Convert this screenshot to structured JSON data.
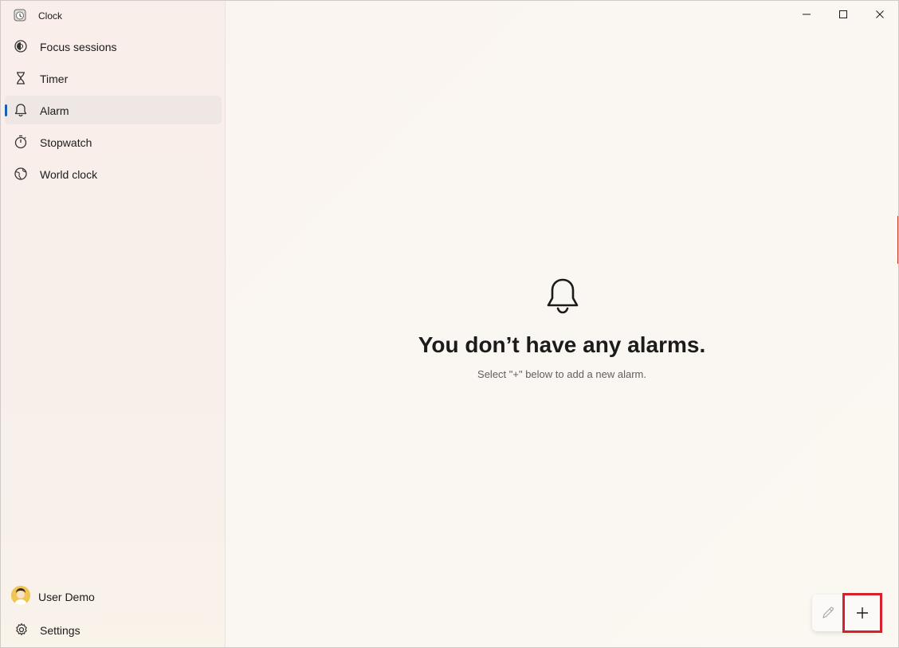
{
  "window": {
    "title": "Clock"
  },
  "sidebar": {
    "items": [
      {
        "label": "Focus sessions",
        "icon": "focus-icon"
      },
      {
        "label": "Timer",
        "icon": "hourglass-icon"
      },
      {
        "label": "Alarm",
        "icon": "bell-icon",
        "active": true
      },
      {
        "label": "Stopwatch",
        "icon": "stopwatch-icon"
      },
      {
        "label": "World clock",
        "icon": "globe-icon"
      }
    ],
    "user": {
      "label": "User Demo"
    },
    "settings": {
      "label": "Settings"
    }
  },
  "empty_state": {
    "title": "You don’t have any alarms.",
    "subtitle": "Select \"+\" below to add a new alarm."
  },
  "colors": {
    "accent": "#1a5fb4",
    "highlight": "#d8202a"
  }
}
